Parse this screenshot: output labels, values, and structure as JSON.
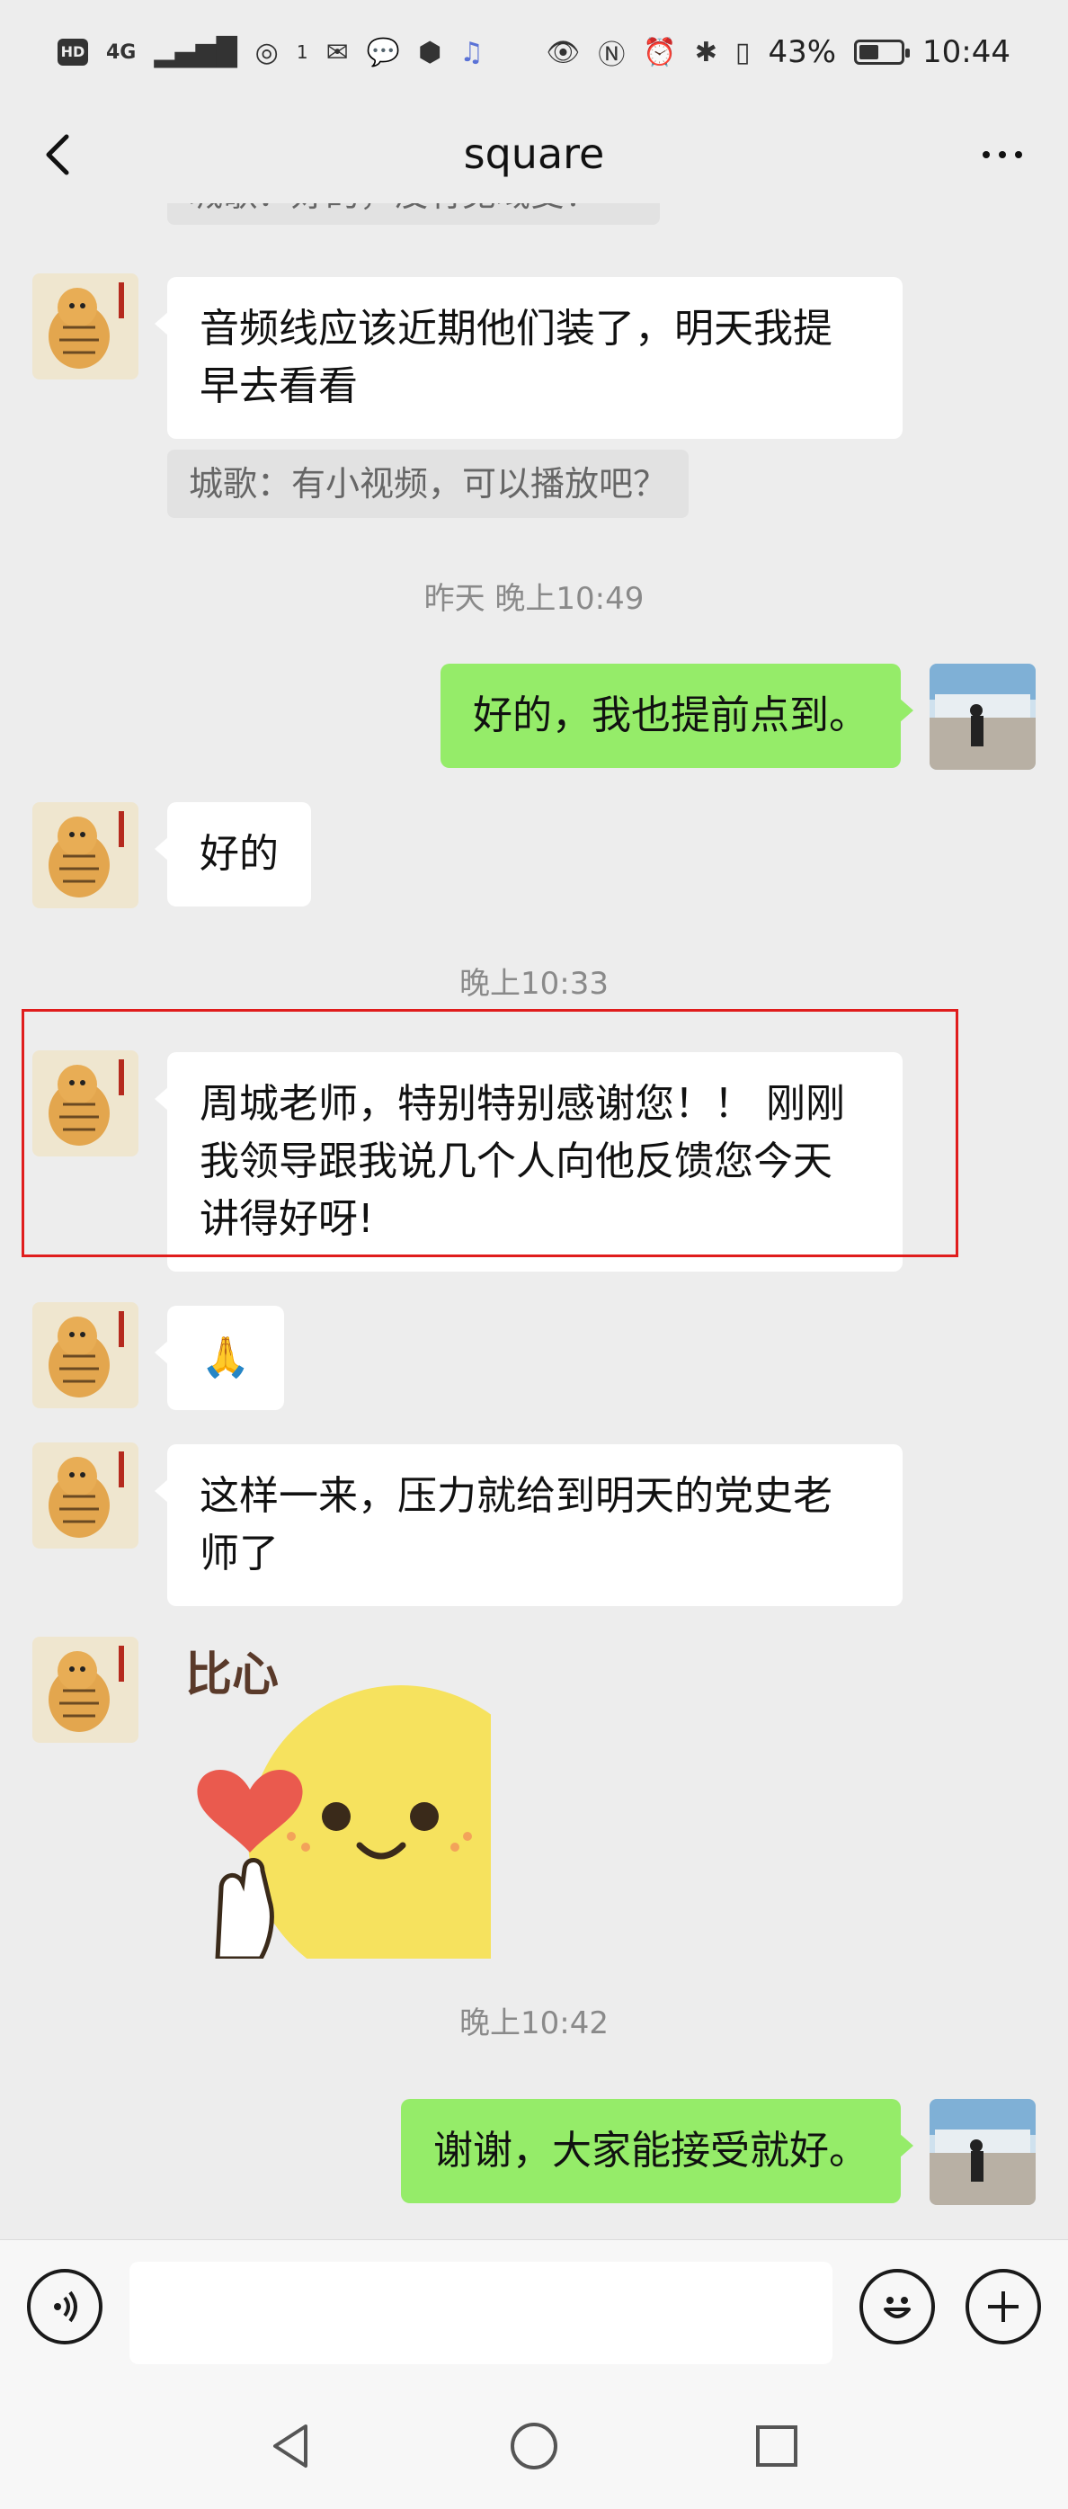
{
  "status_bar": {
    "hd": "HD",
    "network": "4G",
    "signal_count": "1",
    "battery_percent": "43%",
    "time": "10:44"
  },
  "header": {
    "title": "square"
  },
  "chat": {
    "cut_off_quote": "城歌：好的，没有见域受！",
    "messages": [
      {
        "sender": "other",
        "text": "音频线应该近期他们装了，明天我提早去看看"
      },
      {
        "sender": "other_quote",
        "text": "城歌：有小视频，可以播放吧？"
      },
      {
        "sender": "time",
        "text": "昨天 晚上10:49"
      },
      {
        "sender": "me",
        "text": "好的，我也提前点到。"
      },
      {
        "sender": "other",
        "text": "好的"
      },
      {
        "sender": "time",
        "text": "晚上10:33"
      },
      {
        "sender": "other",
        "text": "周城老师，特别特别感谢您！！ 刚刚我领导跟我说几个人向他反馈您今天讲得好呀!"
      },
      {
        "sender": "other",
        "text": "🙏"
      },
      {
        "sender": "other",
        "text": "这样一来，压力就给到明天的党史老师了"
      },
      {
        "sender": "other_sticker",
        "text": "比心"
      },
      {
        "sender": "time",
        "text": "晚上10:42"
      },
      {
        "sender": "me",
        "text": "谢谢，大家能接受就好。"
      }
    ]
  },
  "input_bar": {
    "placeholder": ""
  },
  "colors": {
    "background": "#ededed",
    "outgoing_bubble": "#95ec69",
    "incoming_bubble": "#ffffff",
    "highlight": "#e01d1d"
  },
  "icons": {
    "back": "chevron-left-icon",
    "more": "more-dots-icon",
    "voice": "voice-icon",
    "emoji": "emoji-icon",
    "plus": "plus-icon",
    "nav_back": "nav-back-icon",
    "nav_home": "nav-home-icon",
    "nav_recent": "nav-recent-icon"
  }
}
